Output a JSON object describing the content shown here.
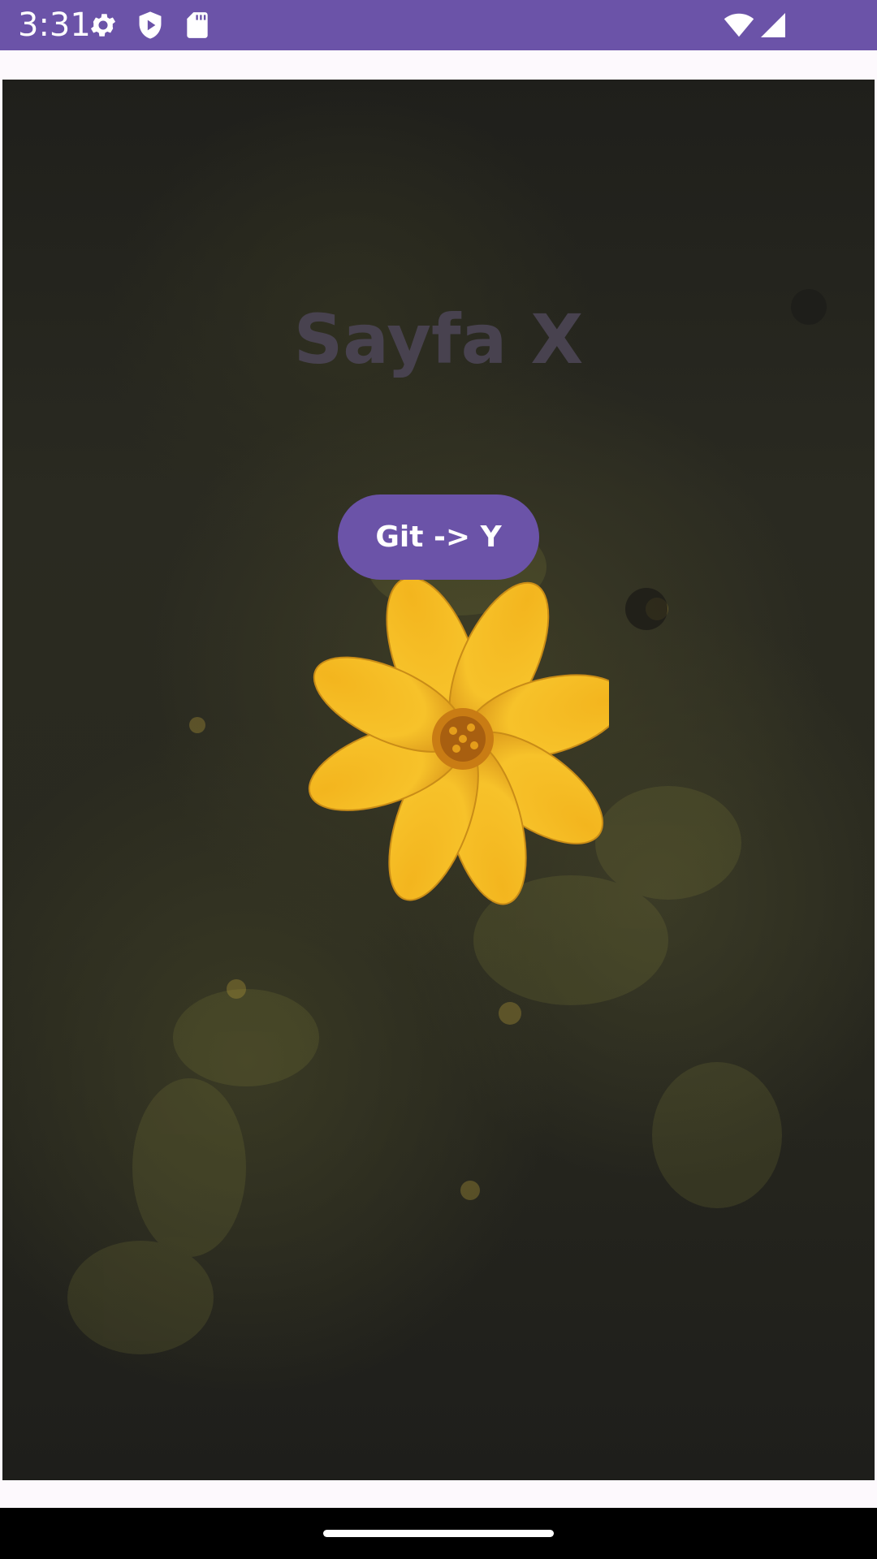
{
  "status_bar": {
    "time": "3:31",
    "icons": [
      "gear-icon",
      "shield-play-icon",
      "sd-card-icon",
      "wifi-icon",
      "signal-icon"
    ],
    "color": "#6b53a8"
  },
  "main": {
    "title": "Sayfa X",
    "button_label": "Git -> Y",
    "accent": "#6b53a8"
  },
  "nav": {
    "handle": "home-handle"
  }
}
